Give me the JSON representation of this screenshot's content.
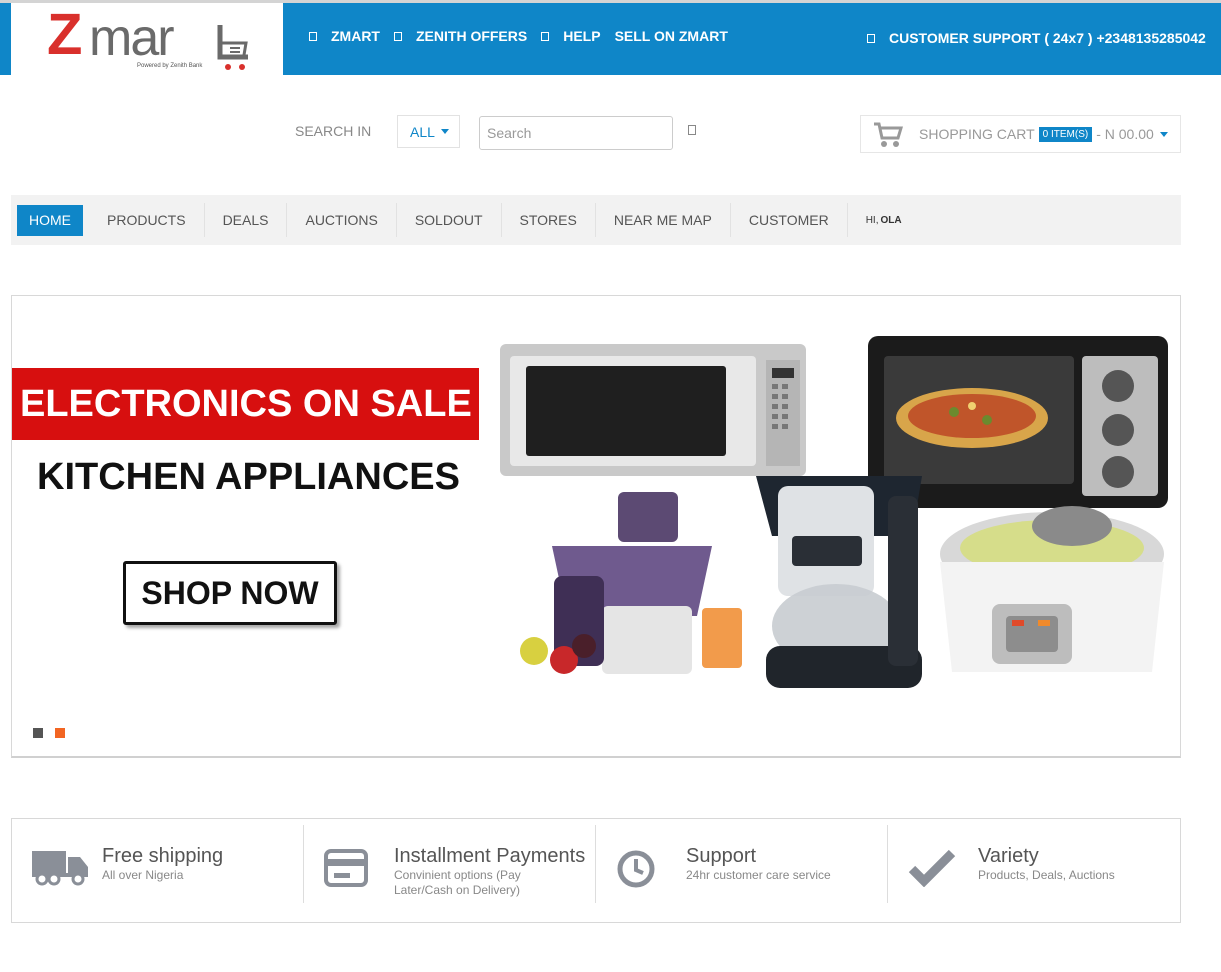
{
  "header": {
    "logo_main": "Z",
    "logo_rest": "mar",
    "logo_tagline": "Powered by Zenith Bank",
    "nav": [
      "ZMART",
      "ZENITH OFFERS",
      "HELP",
      "SELL ON ZMART"
    ],
    "support": "CUSTOMER SUPPORT ( 24x7 ) +2348135285042"
  },
  "search": {
    "label": "SEARCH IN",
    "category": "ALL",
    "placeholder": "Search"
  },
  "cart": {
    "label": "SHOPPING CART",
    "items": "0 ITEM(S)",
    "total": "- N 00.00"
  },
  "mainnav": {
    "items": [
      "HOME",
      "PRODUCTS",
      "DEALS",
      "AUCTIONS",
      "SOLDOUT",
      "STORES",
      "NEAR ME MAP",
      "CUSTOMER"
    ],
    "greeting_prefix": "HI, ",
    "greeting_name": "OLA"
  },
  "banner": {
    "headline": "ELECTRONICS ON SALE",
    "subheadline": "KITCHEN APPLIANCES",
    "cta": "SHOP NOW",
    "slide_dots": 2,
    "active_dot": 2
  },
  "features": [
    {
      "title": "Free shipping",
      "subtitle": "All over Nigeria",
      "icon": "truck-icon"
    },
    {
      "title": "Installment Payments",
      "subtitle": "Convinient options (Pay Later/Cash on Delivery)",
      "icon": "credit-card-icon"
    },
    {
      "title": "Support",
      "subtitle": "24hr customer care service",
      "icon": "clock-icon"
    },
    {
      "title": "Variety",
      "subtitle": "Products, Deals, Auctions",
      "icon": "checkmark-icon"
    }
  ],
  "colors": {
    "brand_blue": "#0f86c8",
    "brand_red": "#d9302c",
    "sale_red": "#d70f0f",
    "dot_inactive": "#555555",
    "dot_active": "#f26522"
  }
}
